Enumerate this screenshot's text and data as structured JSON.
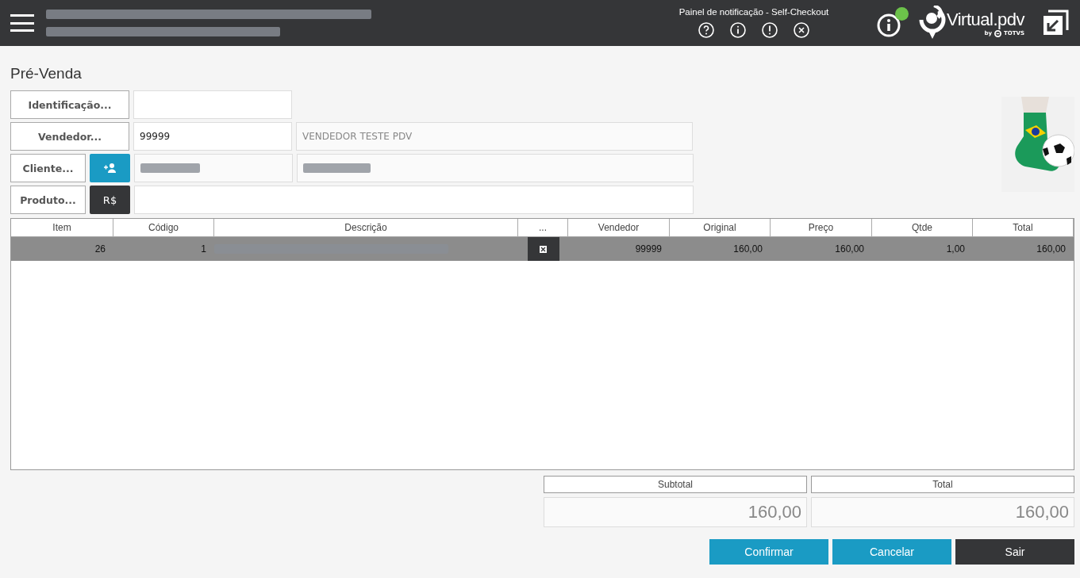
{
  "header": {
    "notification_title": "Painel de notificação - Self-Checkout",
    "brand": "Virtual.pdv",
    "brand_by": "by",
    "brand_vendor": "TOTVS",
    "has_new_info": true
  },
  "page_title": "Pré-Venda",
  "form": [
    {
      "kind": "field",
      "button": "Identificação..."
    },
    {
      "kind": "field_desc",
      "button": "Vendedor...",
      "value": "99999",
      "description": "VENDEDOR TESTE PDV"
    },
    {
      "kind": "client",
      "button": "Cliente..."
    },
    {
      "kind": "product",
      "button": "Produto...",
      "extra_button": "R$"
    }
  ],
  "table": {
    "columns": [
      "Item",
      "Código",
      "Descrição",
      "...",
      "Vendedor",
      "Original",
      "Preço",
      "Qtde",
      "Total"
    ],
    "rows": [
      {
        "selected": true,
        "cells": [
          "26",
          "1",
          null,
          null,
          "99999",
          "160,00",
          "160,00",
          "1,00",
          "160,00"
        ]
      }
    ]
  },
  "totals": [
    {
      "label": "Subtotal",
      "value": "160,00"
    },
    {
      "label": "Total",
      "value": "160,00"
    }
  ],
  "buttons": [
    {
      "label": "Confirmar",
      "kind": "primary"
    },
    {
      "label": "Cancelar",
      "kind": "primary"
    },
    {
      "label": "Sair",
      "kind": "dark"
    }
  ]
}
